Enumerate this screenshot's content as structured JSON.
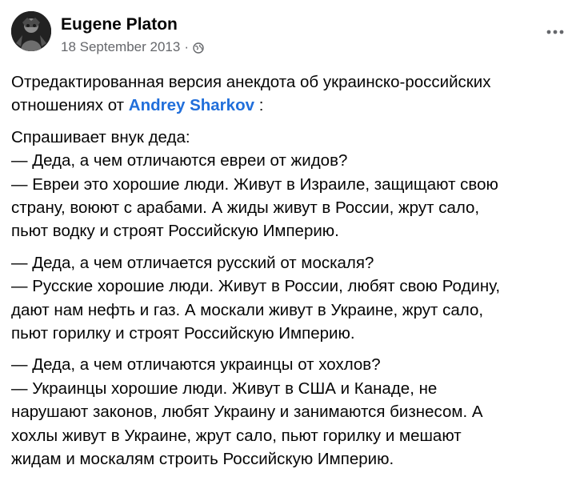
{
  "author": {
    "name": "Eugene Platon",
    "date": "18 September 2013",
    "separator": "·"
  },
  "icons": {
    "avatar": "avatar-image",
    "audience": "globe-icon",
    "menu": "more-options-icon"
  },
  "colors": {
    "mention": "#216fdb",
    "meta": "#65676b",
    "text": "#050505"
  },
  "post": {
    "intro": {
      "line1": "Отредактированная версия анекдота об украинско-российских",
      "line2_prefix": "отношениях от ",
      "mention": "Andrey Sharkov",
      "line2_suffix": " :"
    },
    "paragraph1": [
      "Спрашивает внук деда:",
      "— Деда, а чем отличаются евреи от жидов?",
      "— Евреи это хорошие люди. Живут в Израиле, защищают свою",
      "страну, воюют с арабами. А жиды живут в России, жрут сало,",
      "пьют водку и строят Российскую Империю."
    ],
    "paragraph2": [
      "— Деда, а чем отличается русский от москаля?",
      "— Русские хорошие люди. Живут в России, любят свою Родину,",
      "дают нам нефть и газ. А москали живут в Украине, жрут сало,",
      "пьют горилку и строят Российскую Империю."
    ],
    "paragraph3": [
      "— Деда, а чем отличаются украинцы от хохлов?",
      "— Украинцы хорошие люди. Живут в США и Канаде, не",
      "нарушают законов, любят Украину и занимаются бизнесом. А",
      "хохлы живут в Украине, жрут сало, пьют горилку и мешают",
      "жидам и москалям строить Российскую Империю."
    ]
  }
}
